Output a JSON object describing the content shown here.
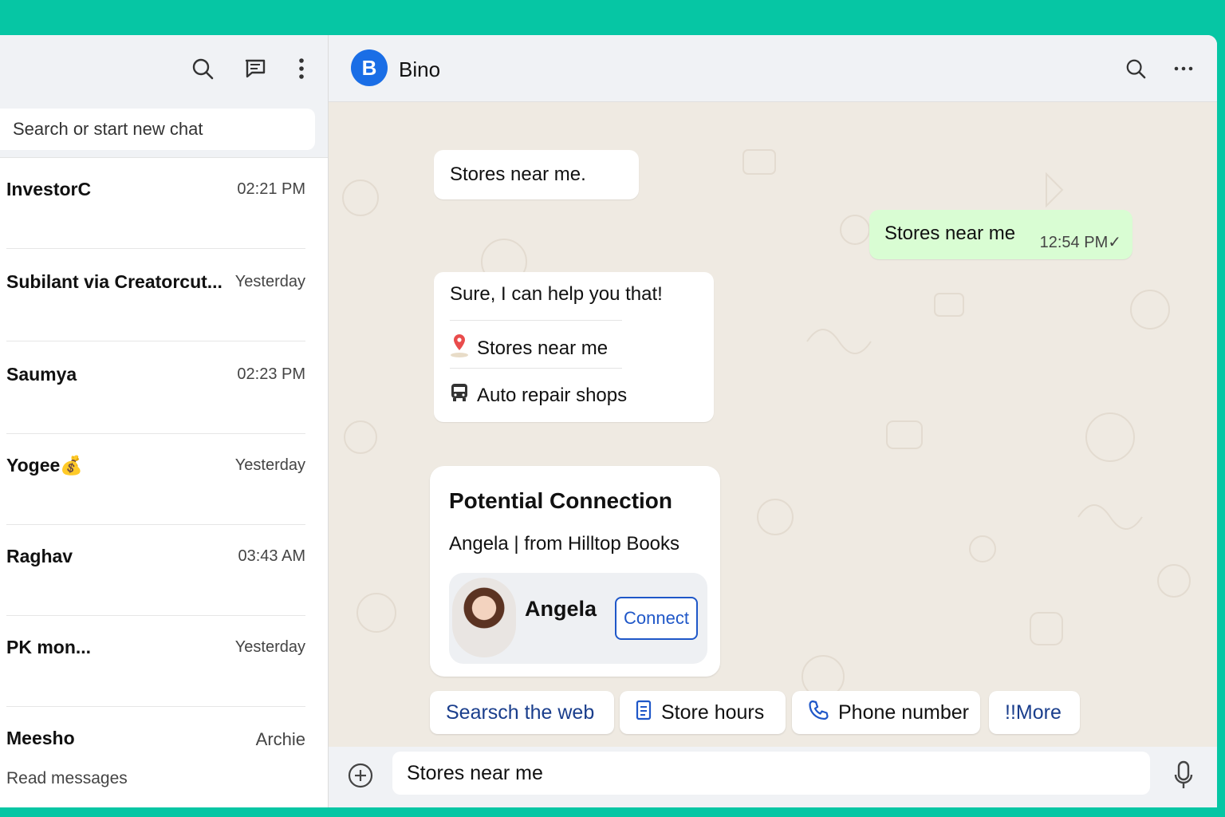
{
  "sidebar": {
    "search_placeholder": "Search or start new chat",
    "chats": [
      {
        "name": "InvestorC",
        "time": "02:21 PM",
        "sub": ""
      },
      {
        "name": "Subilant via Creatorcut...",
        "time": "Yesterday",
        "sub": ""
      },
      {
        "name": "Saumya",
        "time": "02:23 PM",
        "sub": ""
      },
      {
        "name": "Yogee💰",
        "time": "Yesterday",
        "sub": ""
      },
      {
        "name": "Raghav",
        "time": "03:43 AM",
        "sub": ""
      },
      {
        "name": "PK mon...",
        "time": "Yesterday",
        "sub": ""
      },
      {
        "name": "Meesho",
        "time": "Archie",
        "sub": "Read messages"
      }
    ]
  },
  "chat": {
    "avatar_letter": "B",
    "title": "Bino",
    "messages": {
      "m1": "Stores near me.",
      "m2_text": "Stores near me",
      "m2_time": "12:54 PM✓",
      "m3_intro": "Sure, I can help you that!",
      "m3_opt1": "Stores near me",
      "m3_opt2": "Auto repair shops"
    },
    "card": {
      "title": "Potential Connection",
      "subtitle": "Angela | from Hilltop Books",
      "person": "Angela",
      "button": "Connect"
    },
    "chips": [
      {
        "label": "Searsch the web"
      },
      {
        "label": "Store hours"
      },
      {
        "label": "Phone number"
      },
      {
        "label": "!!More"
      }
    ],
    "composer_value": "Stores near me"
  },
  "colors": {
    "accent": "#06c6a4",
    "outgoing_bubble": "#d9fdd3",
    "link_blue": "#1f57c8",
    "avatar_blue": "#1a6ee6",
    "chat_bg": "#efeae2"
  }
}
